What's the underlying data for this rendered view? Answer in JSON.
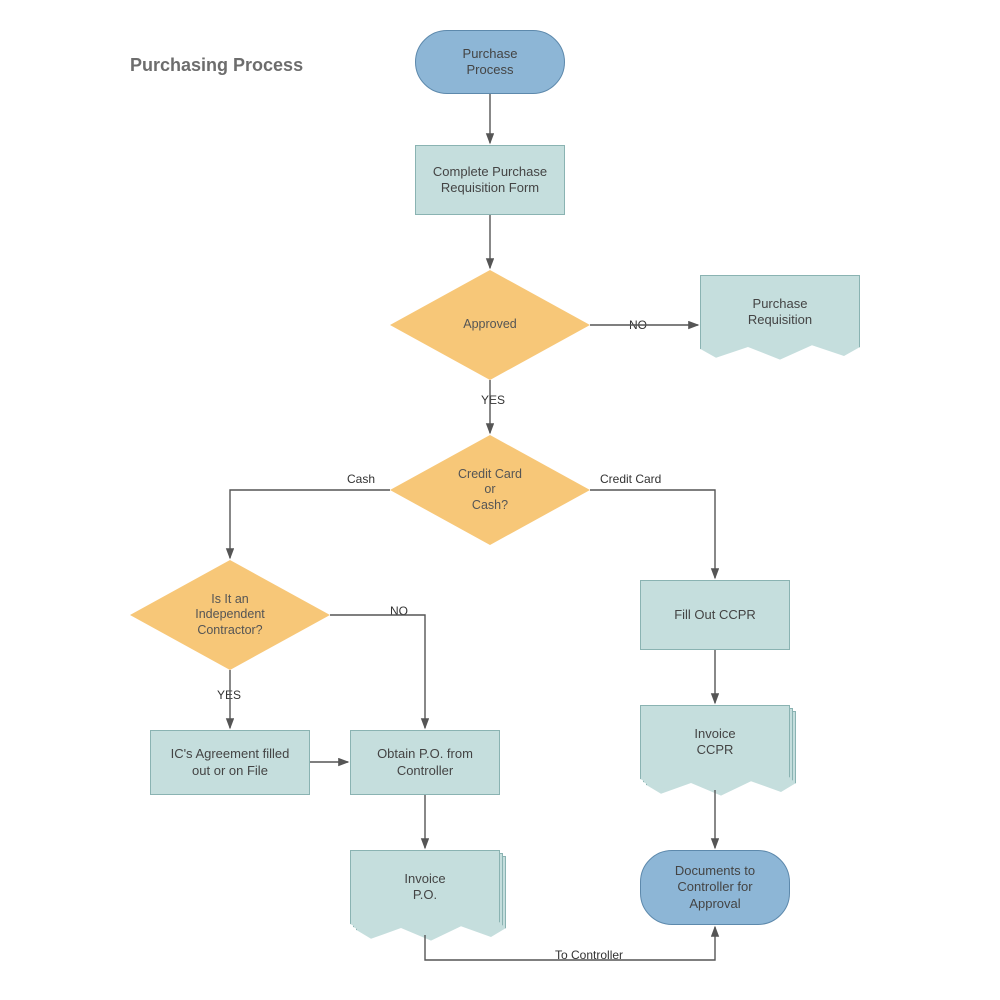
{
  "title": "Purchasing Process",
  "nodes": {
    "start": {
      "label": "Purchase\nProcess"
    },
    "reqform": {
      "label": "Complete Purchase\nRequisition Form"
    },
    "approved": {
      "label": "Approved"
    },
    "doc_preq": {
      "label": "Purchase\nRequisition"
    },
    "cc_or_cash": {
      "label": "Credit Card\nor\nCash?"
    },
    "is_ic": {
      "label": "Is It an\nIndependent\nContractor?"
    },
    "ccpr": {
      "label": "Fill Out CCPR"
    },
    "ic_agree": {
      "label": "IC's Agreement filled\nout or on File"
    },
    "obtain_po": {
      "label": "Obtain P.O. from\nController"
    },
    "inv_ccpr": {
      "label": "Invoice\nCCPR"
    },
    "inv_po": {
      "label": "Invoice\nP.O."
    },
    "docs_ctrl": {
      "label": "Documents to\nController for\nApproval"
    }
  },
  "edgeLabels": {
    "no1": "NO",
    "yes1": "YES",
    "cash": "Cash",
    "credit": "Credit Card",
    "no2": "NO",
    "yes2": "YES",
    "toctrl": "To Controller"
  }
}
